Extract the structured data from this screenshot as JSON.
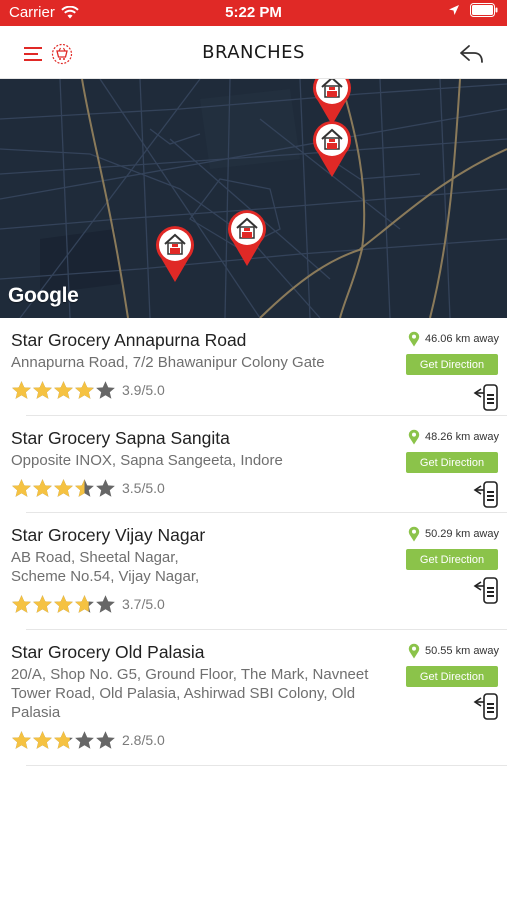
{
  "status_bar": {
    "carrier": "Carrier",
    "time": "5:22 PM"
  },
  "header": {
    "title": "BRANCHES"
  },
  "map": {
    "attribution": "Google"
  },
  "branches": [
    {
      "name": "Star Grocery Annapurna Road",
      "address": "Annapurna Road, 7/2 Bhawanipur Colony Gate",
      "rating": 3.9,
      "rating_text": "3.9/5.0",
      "distance": "46.06 km away",
      "direction_label": "Get Direction"
    },
    {
      "name": "Star Grocery Sapna Sangita",
      "address": "Opposite INOX, Sapna Sangeeta, Indore",
      "rating": 3.5,
      "rating_text": "3.5/5.0",
      "distance": "48.26 km away",
      "direction_label": "Get Direction"
    },
    {
      "name": "Star Grocery Vijay Nagar",
      "address_lines": [
        "AB Road, Sheetal Nagar,",
        "Scheme No.54, Vijay Nagar,"
      ],
      "rating": 3.7,
      "rating_text": "3.7/5.0",
      "distance": "50.29 km away",
      "direction_label": "Get Direction"
    },
    {
      "name": "Star Grocery Old Palasia",
      "address_lines": [
        "20/A, Shop No. G5, Ground Floor, The Mark, Navneet",
        "Tower Road, Old Palasia, Ashirwad SBI Colony, Old",
        "Palasia"
      ],
      "rating": 2.8,
      "rating_text": "2.8/5.0",
      "distance": "50.55 km away",
      "direction_label": "Get Direction"
    }
  ],
  "colors": {
    "brand_red": "#e02926",
    "accent_green": "#8bc34a",
    "star_gold": "#f5c242",
    "star_grey": "#666666",
    "map_bg": "#1e2a38"
  }
}
